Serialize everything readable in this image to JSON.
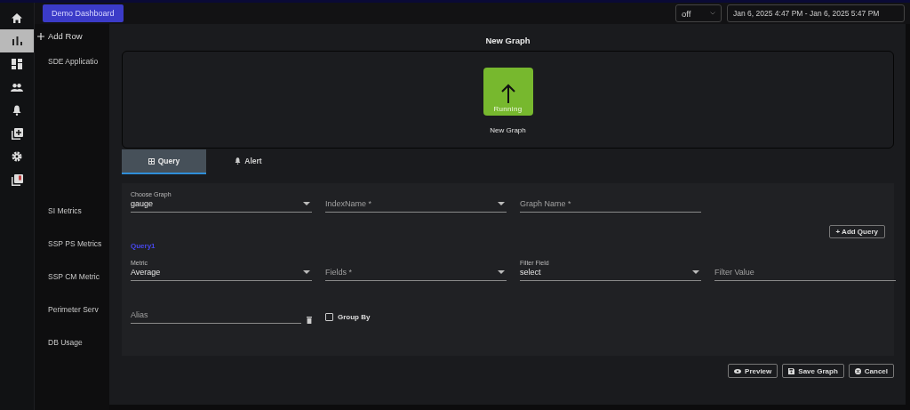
{
  "nav_rail": {
    "items": [
      {
        "kind": "home",
        "selected": false
      },
      {
        "kind": "chart",
        "selected": true
      },
      {
        "kind": "dashboard",
        "selected": false
      },
      {
        "kind": "people",
        "selected": false
      },
      {
        "kind": "bell",
        "selected": false
      },
      {
        "kind": "add",
        "selected": false
      },
      {
        "kind": "gear",
        "selected": false
      },
      {
        "kind": "library",
        "selected": false
      }
    ]
  },
  "top_bar": {
    "dashboard_button": "Demo Dashboard",
    "refresh_select": "off",
    "time_range": "Jan 6, 2025 4:47 PM - Jan 6, 2025 5:47 PM"
  },
  "left_panel": {
    "add_row": "Add Row",
    "rows": [
      "SDE Applicatio",
      "SI Metrics",
      "SSP PS Metrics",
      "SSP CM Metric",
      "Perimeter Serv",
      "DB Usage"
    ]
  },
  "dialog": {
    "title": "New Graph",
    "preview": {
      "status": "Running",
      "graph_name": "New Graph"
    },
    "tabs": [
      {
        "kind": "query",
        "label": "Query",
        "selected": true
      },
      {
        "kind": "alert",
        "label": "Alert",
        "selected": false
      }
    ],
    "form": {
      "choose_graph": {
        "label": "Choose Graph",
        "value": "gauge"
      },
      "index_name": {
        "placeholder": "IndexName *"
      },
      "graph_name": {
        "placeholder": "Graph Name *"
      },
      "add_query": "+ Add Query",
      "queries": [
        {
          "title": "Query1",
          "metric": {
            "label": "Metric",
            "value": "Average"
          },
          "fields": {
            "placeholder": "Fields *"
          },
          "filter_field": {
            "label": "Filter Field",
            "value": "select"
          },
          "filter_value": {
            "placeholder": "Filter Value"
          },
          "alias": {
            "placeholder": "Alias"
          },
          "group_by": {
            "label": "Group By",
            "checked": false
          }
        }
      ]
    },
    "buttons": [
      {
        "kind": "preview",
        "label": "Preview"
      },
      {
        "kind": "save",
        "label": "Save Graph"
      },
      {
        "kind": "cancel",
        "label": "Cancel"
      }
    ]
  }
}
